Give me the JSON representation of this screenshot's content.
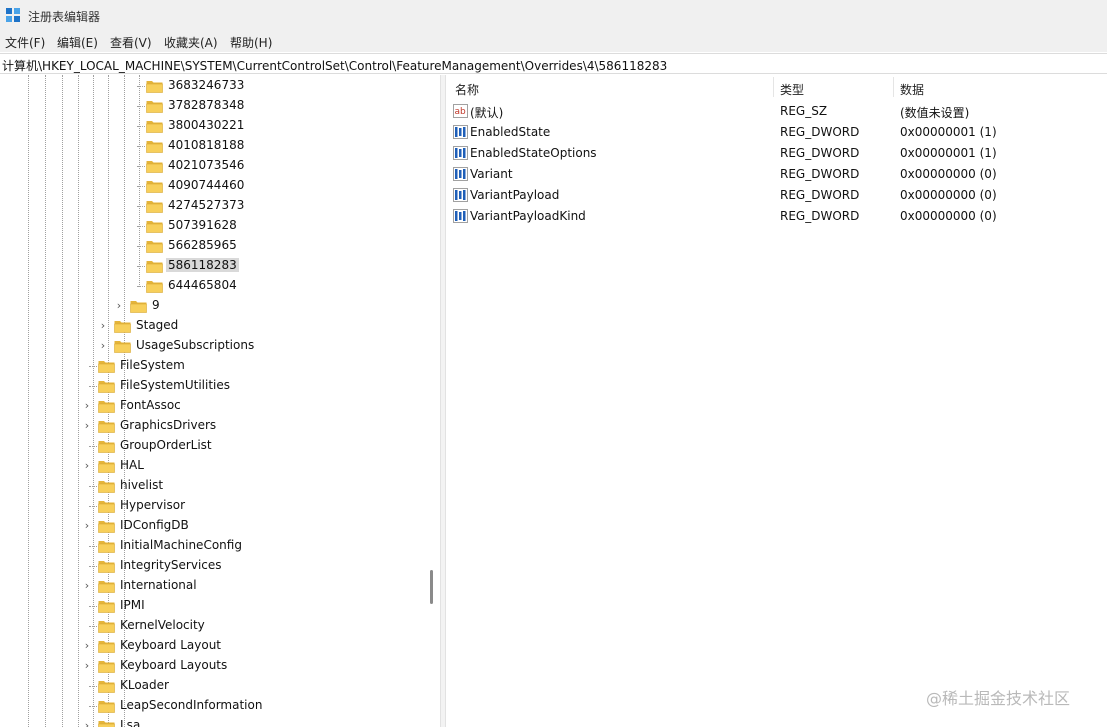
{
  "window": {
    "title": "注册表编辑器"
  },
  "menu": [
    "文件(F)",
    "编辑(E)",
    "查看(V)",
    "收藏夹(A)",
    "帮助(H)"
  ],
  "address": "计算机\\HKEY_LOCAL_MACHINE\\SYSTEM\\CurrentControlSet\\Control\\FeatureManagement\\Overrides\\4\\586118283",
  "tree": [
    {
      "label": "3683246733",
      "level": 3,
      "expander": false,
      "selected": false
    },
    {
      "label": "3782878348",
      "level": 3,
      "expander": false,
      "selected": false
    },
    {
      "label": "3800430221",
      "level": 3,
      "expander": false,
      "selected": false
    },
    {
      "label": "4010818188",
      "level": 3,
      "expander": false,
      "selected": false
    },
    {
      "label": "4021073546",
      "level": 3,
      "expander": false,
      "selected": false
    },
    {
      "label": "4090744460",
      "level": 3,
      "expander": false,
      "selected": false
    },
    {
      "label": "4274527373",
      "level": 3,
      "expander": false,
      "selected": false
    },
    {
      "label": "507391628",
      "level": 3,
      "expander": false,
      "selected": false
    },
    {
      "label": "566285965",
      "level": 3,
      "expander": false,
      "selected": false
    },
    {
      "label": "586118283",
      "level": 3,
      "expander": false,
      "selected": true
    },
    {
      "label": "644465804",
      "level": 3,
      "expander": false,
      "selected": false
    },
    {
      "label": "9",
      "level": 2,
      "expander": true,
      "selected": false
    },
    {
      "label": "Staged",
      "level": 1,
      "expander": true,
      "selected": false
    },
    {
      "label": "UsageSubscriptions",
      "level": 1,
      "expander": true,
      "selected": false
    },
    {
      "label": "FileSystem",
      "level": 0,
      "expander": false,
      "selected": false
    },
    {
      "label": "FileSystemUtilities",
      "level": 0,
      "expander": false,
      "selected": false
    },
    {
      "label": "FontAssoc",
      "level": 0,
      "expander": true,
      "selected": false
    },
    {
      "label": "GraphicsDrivers",
      "level": 0,
      "expander": true,
      "selected": false
    },
    {
      "label": "GroupOrderList",
      "level": 0,
      "expander": false,
      "selected": false
    },
    {
      "label": "HAL",
      "level": 0,
      "expander": true,
      "selected": false
    },
    {
      "label": "hivelist",
      "level": 0,
      "expander": false,
      "selected": false
    },
    {
      "label": "Hypervisor",
      "level": 0,
      "expander": false,
      "selected": false
    },
    {
      "label": "IDConfigDB",
      "level": 0,
      "expander": true,
      "selected": false
    },
    {
      "label": "InitialMachineConfig",
      "level": 0,
      "expander": false,
      "selected": false
    },
    {
      "label": "IntegrityServices",
      "level": 0,
      "expander": false,
      "selected": false
    },
    {
      "label": "International",
      "level": 0,
      "expander": true,
      "selected": false
    },
    {
      "label": "IPMI",
      "level": 0,
      "expander": false,
      "selected": false
    },
    {
      "label": "KernelVelocity",
      "level": 0,
      "expander": false,
      "selected": false
    },
    {
      "label": "Keyboard Layout",
      "level": 0,
      "expander": true,
      "selected": false
    },
    {
      "label": "Keyboard Layouts",
      "level": 0,
      "expander": true,
      "selected": false
    },
    {
      "label": "KLoader",
      "level": 0,
      "expander": false,
      "selected": false
    },
    {
      "label": "LeapSecondInformation",
      "level": 0,
      "expander": false,
      "selected": false
    },
    {
      "label": "Lsa",
      "level": 0,
      "expander": true,
      "selected": false
    }
  ],
  "list": {
    "columns": [
      "名称",
      "类型",
      "数据"
    ],
    "rows": [
      {
        "name": "(默认)",
        "type": "REG_SZ",
        "data": "(数值未设置)",
        "icon": "string-value-icon"
      },
      {
        "name": "EnabledState",
        "type": "REG_DWORD",
        "data": "0x00000001 (1)",
        "icon": "binary-value-icon"
      },
      {
        "name": "EnabledStateOptions",
        "type": "REG_DWORD",
        "data": "0x00000001 (1)",
        "icon": "binary-value-icon"
      },
      {
        "name": "Variant",
        "type": "REG_DWORD",
        "data": "0x00000000 (0)",
        "icon": "binary-value-icon"
      },
      {
        "name": "VariantPayload",
        "type": "REG_DWORD",
        "data": "0x00000000 (0)",
        "icon": "binary-value-icon"
      },
      {
        "name": "VariantPayloadKind",
        "type": "REG_DWORD",
        "data": "0x00000000 (0)",
        "icon": "binary-value-icon"
      }
    ]
  },
  "watermark": "@稀土掘金技术社区",
  "colors": {
    "folder": "#f7cf5a",
    "folder_dark": "#e4b43a",
    "selection": "#d9d9d9"
  }
}
